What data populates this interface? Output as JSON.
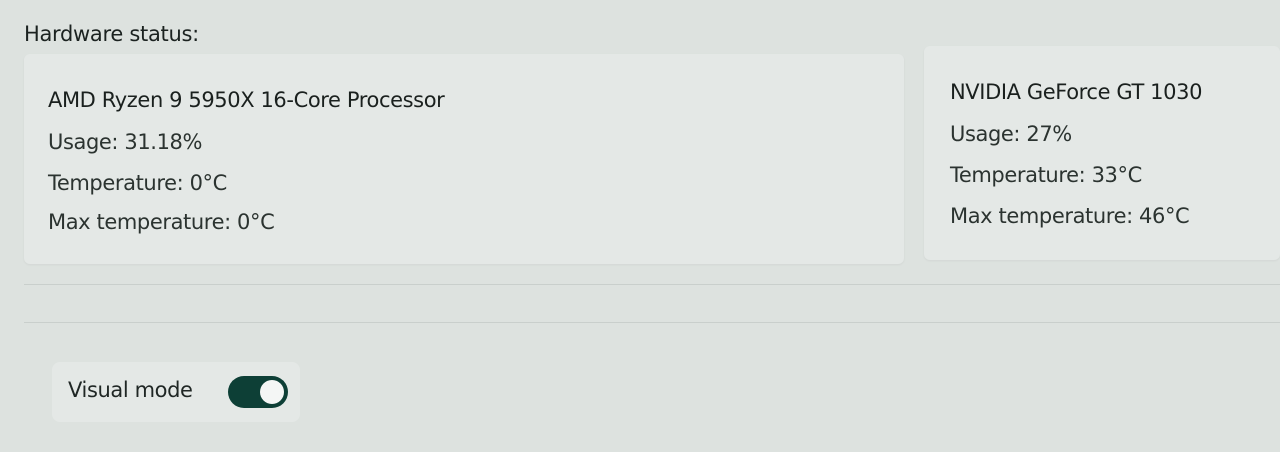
{
  "hardware": {
    "title": "Hardware status:",
    "cpu": {
      "name": "AMD Ryzen 9 5950X 16-Core Processor",
      "usage": "Usage: 31.18%",
      "temperature": "Temperature: 0°C",
      "max_temperature": "Max temperature: 0°C"
    },
    "gpu": {
      "name": "NVIDIA GeForce GT 1030",
      "usage": "Usage: 27%",
      "temperature": "Temperature: 33°C",
      "max_temperature": "Max temperature: 46°C"
    }
  },
  "settings": {
    "visual_mode_label": "Visual mode",
    "visual_mode_enabled": true
  },
  "colors": {
    "toggle_on": "#0d3f36",
    "background": "#dde2df"
  }
}
